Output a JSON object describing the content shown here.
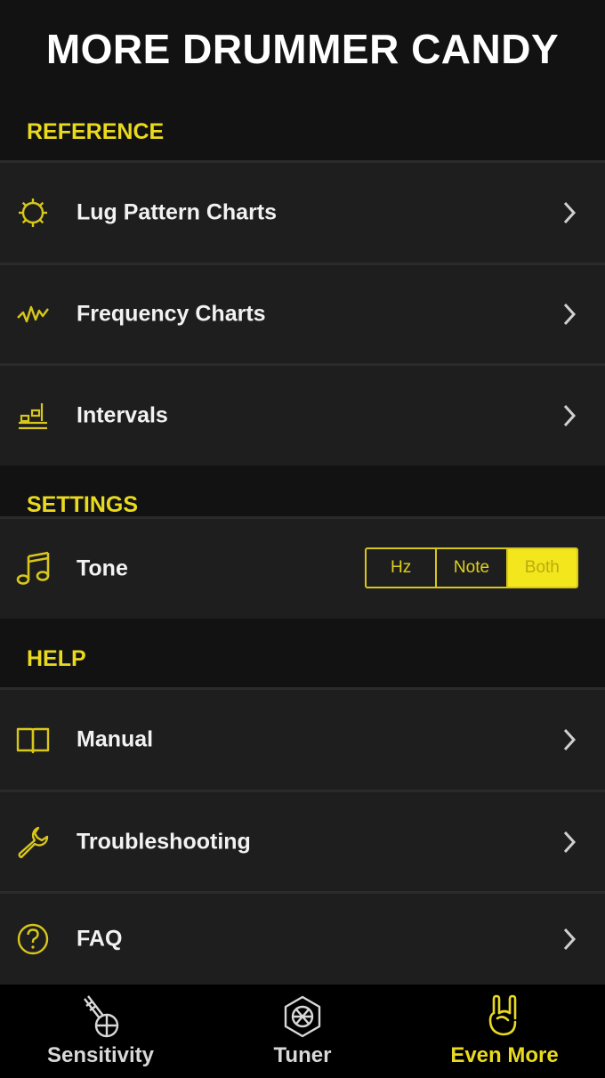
{
  "header": {
    "title": "MORE DRUMMER CANDY"
  },
  "colors": {
    "accent": "#e9da1e",
    "background": "#121212",
    "row": "#1e1e1e",
    "tabbar": "#000000"
  },
  "sections": {
    "reference": {
      "title": "REFERENCE",
      "items": [
        {
          "label": "Lug Pattern Charts",
          "icon": "lug-icon"
        },
        {
          "label": "Frequency Charts",
          "icon": "frequency-icon"
        },
        {
          "label": "Intervals",
          "icon": "intervals-icon"
        }
      ]
    },
    "settings": {
      "title": "SETTINGS",
      "tone": {
        "label": "Tone",
        "icon": "music-note-icon",
        "options": [
          "Hz",
          "Note",
          "Both"
        ],
        "selected": "Both"
      }
    },
    "help": {
      "title": "HELP",
      "items": [
        {
          "label": "Manual",
          "icon": "book-icon"
        },
        {
          "label": "Troubleshooting",
          "icon": "wrench-icon"
        },
        {
          "label": "FAQ",
          "icon": "question-icon"
        }
      ]
    }
  },
  "tabbar": {
    "tabs": [
      {
        "label": "Sensitivity",
        "icon": "sensitivity-icon",
        "active": false
      },
      {
        "label": "Tuner",
        "icon": "tuner-icon",
        "active": false
      },
      {
        "label": "Even More",
        "icon": "rock-hand-icon",
        "active": true
      }
    ]
  }
}
